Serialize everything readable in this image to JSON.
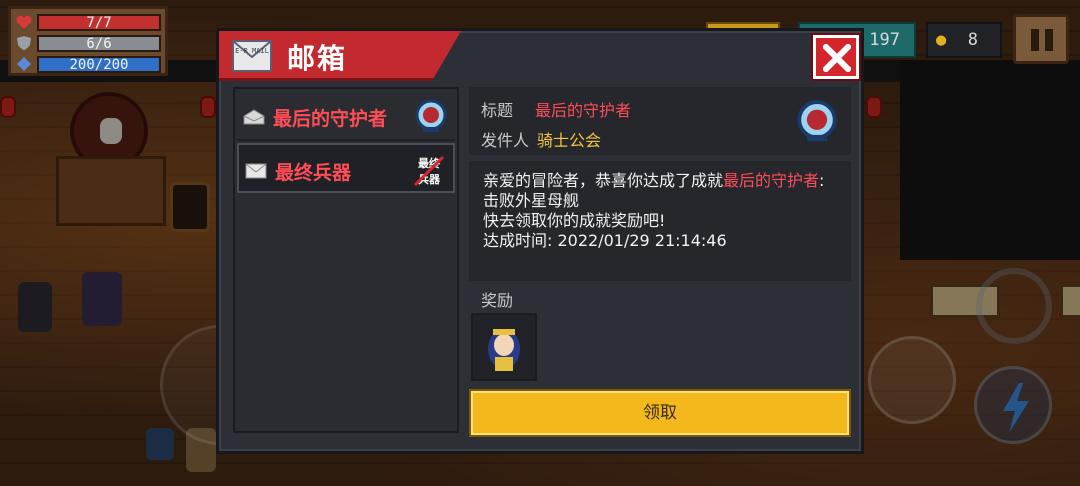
{
  "hud": {
    "hp": "7/7",
    "armor": "6/6",
    "energy": "200/200",
    "gems": "197",
    "coins": "8"
  },
  "mailbox": {
    "title": "邮箱",
    "header_icon_text": "E-R MAIL",
    "mails": [
      {
        "label": "最后的守护者",
        "read": true
      },
      {
        "label": "最终兵器",
        "read": false,
        "thumb_text": "最终兵器"
      }
    ],
    "detail": {
      "subject_key": "标题",
      "subject_value": "最后的守护者",
      "sender_key": "发件人",
      "sender_value": "骑士公会",
      "body_pre": "亲爱的冒险者，恭喜你达成了成就",
      "body_highlight": "最后的守护者",
      "body_post": ":击败外星母舰",
      "body_line2": "快去领取你的成就奖励吧!",
      "body_line3": "达成时间: 2022/01/29 21:14:46"
    },
    "reward_label": "奖励",
    "claim_label": "领取"
  },
  "colors": {
    "accent_red": "#ff4d57",
    "header_red": "#c22a30",
    "claim_yellow": "#f2b81c",
    "sender_yellow": "#f5c43b"
  }
}
